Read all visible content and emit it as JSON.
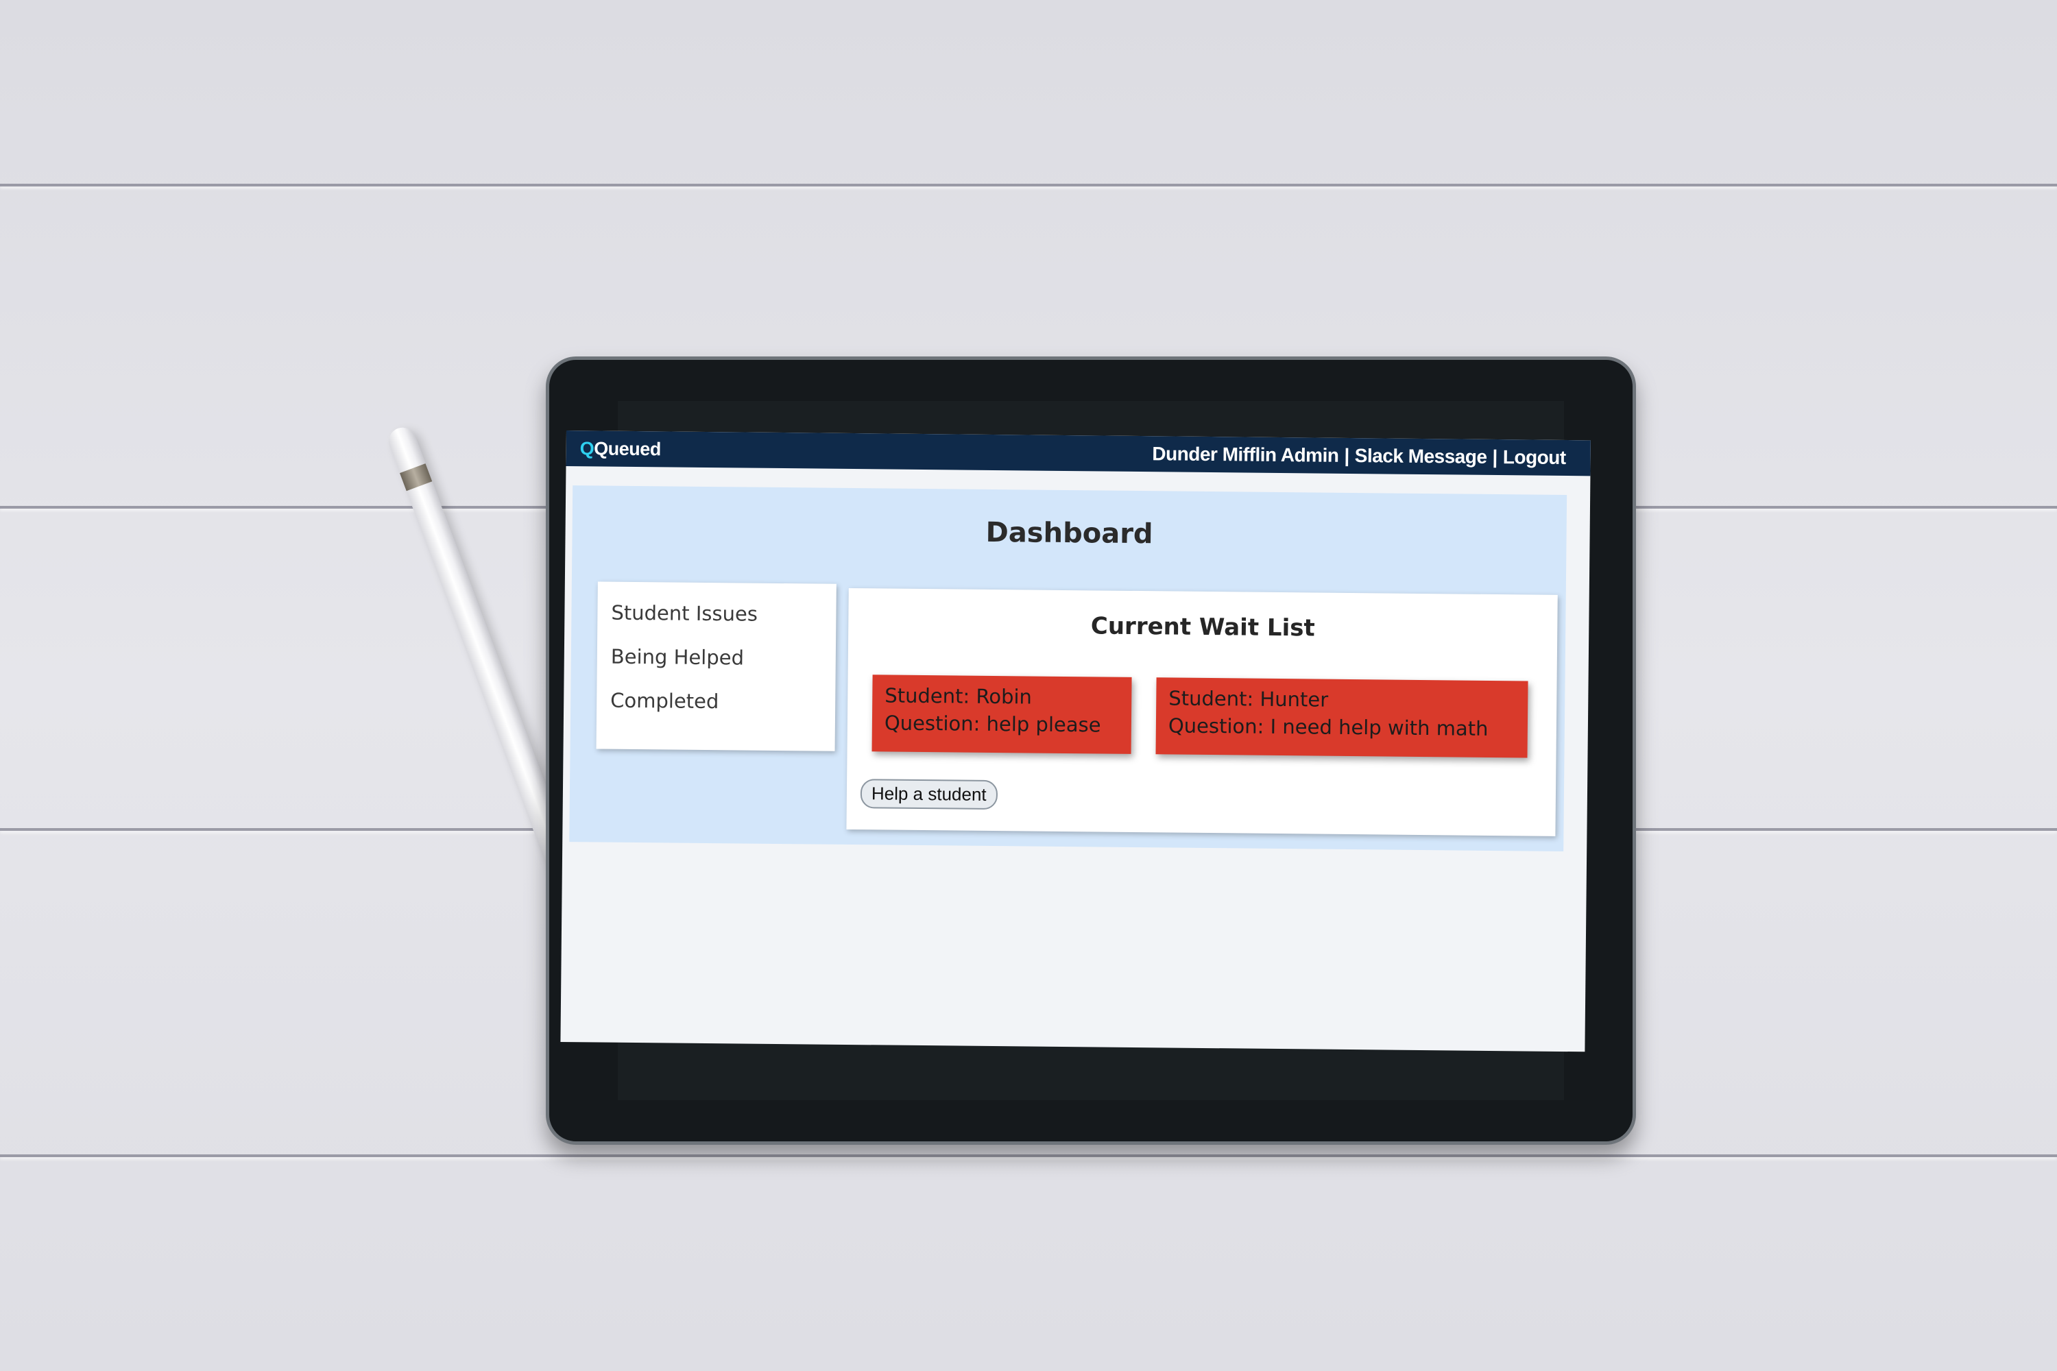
{
  "app": {
    "brand_prefix": "Q",
    "brand_rest": "Queued"
  },
  "nav": {
    "admin": "Dunder Mifflin Admin",
    "separator": "|",
    "slack": "Slack Message",
    "logout": "Logout"
  },
  "page": {
    "title": "Dashboard"
  },
  "sidebar": {
    "items": [
      {
        "label": "Student Issues"
      },
      {
        "label": "Being Helped"
      },
      {
        "label": "Completed"
      }
    ]
  },
  "waitlist": {
    "title": "Current Wait List",
    "cards": [
      {
        "student": "Student: Robin",
        "question": "Question: help please"
      },
      {
        "student": "Student: Hunter",
        "question": "Question: I need help with math"
      }
    ],
    "help_button": "Help a student"
  },
  "colors": {
    "navbar": "#0f2a4a",
    "brand_accent": "#2fd0f0",
    "panel": "#d3e6fa",
    "card": "#d93a2b"
  }
}
